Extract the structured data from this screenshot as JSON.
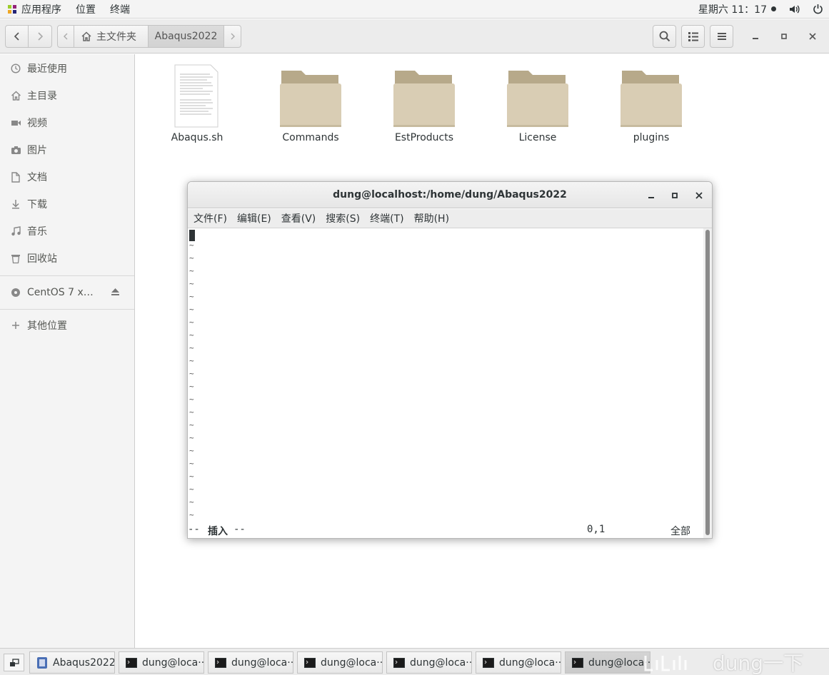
{
  "top_panel": {
    "apps": "应用程序",
    "places": "位置",
    "terminal": "终端",
    "clock": "星期六  11：17"
  },
  "headerbar": {
    "home_label": "主文件夹",
    "current_folder": "Abaqus2022"
  },
  "sidebar": {
    "items": [
      {
        "label": "最近使用",
        "icon": "clock-icon"
      },
      {
        "label": "主目录",
        "icon": "home-icon"
      },
      {
        "label": "视频",
        "icon": "video-icon"
      },
      {
        "label": "图片",
        "icon": "camera-icon"
      },
      {
        "label": "文档",
        "icon": "document-icon"
      },
      {
        "label": "下载",
        "icon": "download-icon"
      },
      {
        "label": "音乐",
        "icon": "music-icon"
      },
      {
        "label": "回收站",
        "icon": "trash-icon"
      }
    ],
    "device": "CentOS 7 x…",
    "other": "其他位置"
  },
  "files": [
    {
      "name": "Abaqus.sh",
      "type": "text-file"
    },
    {
      "name": "Commands",
      "type": "folder"
    },
    {
      "name": "EstProducts",
      "type": "folder"
    },
    {
      "name": "License",
      "type": "folder"
    },
    {
      "name": "plugins",
      "type": "folder"
    }
  ],
  "terminal": {
    "title": "dung@localhost:/home/dung/Abaqus2022",
    "menu": [
      "文件(F)",
      "编辑(E)",
      "查看(V)",
      "搜索(S)",
      "终端(T)",
      "帮助(H)"
    ],
    "tilde": "~",
    "status_left_prefix": "-- ",
    "status_mode": "插入",
    "status_left_suffix": " --",
    "status_pos": "0,1",
    "status_all": "全部"
  },
  "taskbar": {
    "items": [
      {
        "label": "Abaqus2022",
        "icon": "file-manager-icon"
      },
      {
        "label": "dung@loca···",
        "icon": "terminal-icon"
      },
      {
        "label": "dung@loca···",
        "icon": "terminal-icon"
      },
      {
        "label": "dung@loca···",
        "icon": "terminal-icon"
      },
      {
        "label": "dung@loca···",
        "icon": "terminal-icon"
      },
      {
        "label": "dung@loca···",
        "icon": "terminal-icon"
      },
      {
        "label": "dung@loca···",
        "icon": "terminal-icon"
      }
    ],
    "watermark": "dung一下"
  },
  "colors": {
    "folder": "#d9cdb4",
    "folder_tab": "#b7a98a",
    "panel": "#f4f4f4"
  }
}
